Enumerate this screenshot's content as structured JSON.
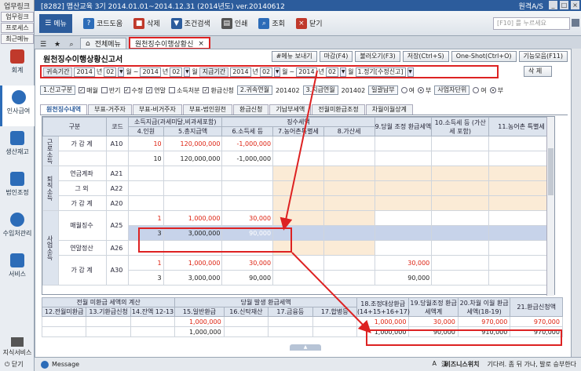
{
  "titlebar": {
    "left_tag": "업무링크",
    "title": "[8282] 맵산교육   3기 2014.01.01~2014.12.31 (2014년도)   ver.20140612",
    "right": "원격A/S"
  },
  "sidebar": {
    "tags": [
      "업무링크",
      "프로세스",
      "최근메뉴"
    ],
    "modules": [
      {
        "label": "회계",
        "color": "#c0392b"
      },
      {
        "label": "인사급여",
        "color": "#2c6cb8",
        "active": true
      },
      {
        "label": "생산재고",
        "color": "#2c6cb8"
      },
      {
        "label": "법인조정",
        "color": "#2c6cb8"
      },
      {
        "label": "수입처관리",
        "color": "#2c6cb8"
      },
      {
        "label": "서비스",
        "color": "#2c6cb8"
      }
    ],
    "bottom_label": "지식서비스",
    "close_label": "닫기"
  },
  "toolbar": {
    "menu_label": "메뉴",
    "buttons": [
      {
        "label": "코드도움",
        "icon": "question-icon",
        "color": "#2c6cb8"
      },
      {
        "label": "삭제",
        "icon": "delete-icon",
        "color": "#c0392b"
      },
      {
        "label": "조건검색",
        "icon": "filter-icon",
        "color": "#2c5c9c"
      },
      {
        "label": "인쇄",
        "icon": "print-icon",
        "color": "#555"
      },
      {
        "label": "조회",
        "icon": "search-icon",
        "color": "#2c6cb8"
      },
      {
        "label": "닫기",
        "icon": "close-icon",
        "color": "#c0392b"
      }
    ],
    "search_placeholder": "[F10] 를 누르세요"
  },
  "tabs": [
    {
      "label": "전체메뉴"
    },
    {
      "label": "원천징수이행상황신",
      "active": true
    }
  ],
  "page": {
    "title": "원천징수이행상황신고서",
    "actions": [
      "#메뉴 보내기",
      "마감(F4)",
      "불러오기(F3)",
      "저장(Ctrl+S)",
      "One-Shot(Ctrl+O)",
      "기능모음(F11)"
    ]
  },
  "filter": {
    "period_label": "귀속기간",
    "from_year": "2014",
    "year_unit": "년",
    "from_month": "02",
    "month_unit": "월",
    "sep": "~",
    "to_year": "2014",
    "to_month": "02",
    "pay_label": "지급기간",
    "pay_from_year": "2014",
    "pay_from_month": "02",
    "pay_to_year": "2014",
    "pay_to_month": "02",
    "report_type": "1.정기[수정신고]",
    "delete_label": "삭 제"
  },
  "options": {
    "report_kind_label": "1.신고구분",
    "checks": [
      {
        "label": "매월",
        "checked": true
      },
      {
        "label": "반기",
        "checked": false
      },
      {
        "label": "수정",
        "checked": true
      },
      {
        "label": "연말",
        "checked": true
      },
      {
        "label": "소득처분",
        "checked": false
      },
      {
        "label": "환급신청",
        "checked": true
      }
    ],
    "attr_label": "2.귀속연월",
    "attr_value": "201402",
    "pay_ym_label": "3.지급연월",
    "pay_ym_value": "201402",
    "batch_label": "일괄납부",
    "yes": "여",
    "no": "부",
    "unit_label": "사업자단위"
  },
  "subtabs": [
    "원천징수내역",
    "부표-거주자",
    "부표-비거주자",
    "부표-법인원천",
    "환급신청",
    "기납부세액",
    "전월미환급조정",
    "차월이월상계"
  ],
  "grid": {
    "headers_top": [
      "구분",
      "코드",
      "소득지급(과세미달,비과세포함)",
      "징수세액",
      "9.당월 조정 환급세액",
      "10.소득세 등 (가산세 포함)",
      "11.농어촌 특별세"
    ],
    "headers_sub": [
      "4.인원",
      "5.총지급액",
      "6.소득세 등",
      "7.농어촌특별세",
      "8.가산세"
    ],
    "group_top": "근로소득",
    "group_retire": "퇴직소득",
    "group_business": "사업소득",
    "rows": [
      {
        "name": "가 감 계",
        "code": "A10",
        "people": "10",
        "total": "120,000,000",
        "tax": "-1,000,000",
        "red": true
      },
      {
        "name": "",
        "code": "",
        "people": "10",
        "total": "120,000,000",
        "tax": "-1,000,000",
        "red": false
      },
      {
        "name": "연금계좌",
        "code": "A21",
        "people": "",
        "total": "",
        "tax": ""
      },
      {
        "name": "그 외",
        "code": "A22",
        "people": "",
        "total": "",
        "tax": ""
      },
      {
        "name": "가 감 계",
        "code": "A20",
        "people": "",
        "total": "",
        "tax": ""
      },
      {
        "name": "매월징수",
        "code": "A25",
        "people": "1",
        "total": "1,000,000",
        "tax": "30,000",
        "red": true
      },
      {
        "name": "",
        "code": "",
        "people": "3",
        "total": "3,000,000",
        "tax": "90,000",
        "sel": true
      },
      {
        "name": "연말정산",
        "code": "A26",
        "people": "",
        "total": "",
        "tax": ""
      },
      {
        "name": "가 감 계",
        "code": "A30",
        "people": "1",
        "total": "1,000,000",
        "tax": "30,000",
        "red": true,
        "adj": "30,000"
      },
      {
        "name": "",
        "code": "",
        "people": "3",
        "total": "3,000,000",
        "tax": "90,000",
        "adj": "90,000"
      }
    ]
  },
  "bottom": {
    "group1": "전월 미환급 세액의 계산",
    "group2": "당월 발생 환급세액",
    "headers": [
      "12.전월미환급",
      "13.기환급신청",
      "14.잔액 12-13",
      "15.일반환급",
      "16.신탁재산",
      "17.금융등",
      "17.합병등",
      "18.조정대상환급 (14+15+16+17)",
      "19.당월조정 환급세액계",
      "20.차월 이월 환급세액(18-19)",
      "21.환급신청액"
    ],
    "row1": {
      "general": "1,000,000",
      "adj_target": "1,000,000",
      "adj_month": "30,000",
      "carry": "970,000",
      "refund": "970,000"
    },
    "row2": {
      "general": "1,000,000",
      "adj_target": "1,000,000",
      "adj_month": "90,000",
      "carry": "910,000",
      "refund": "970,000"
    }
  },
  "status": {
    "message": "Message",
    "icons": [
      "A",
      "漢"
    ],
    "tip_label": "비즈니스위치",
    "tip_text": "기다려. 좀 뒤 가나, 발로 승부한다"
  }
}
